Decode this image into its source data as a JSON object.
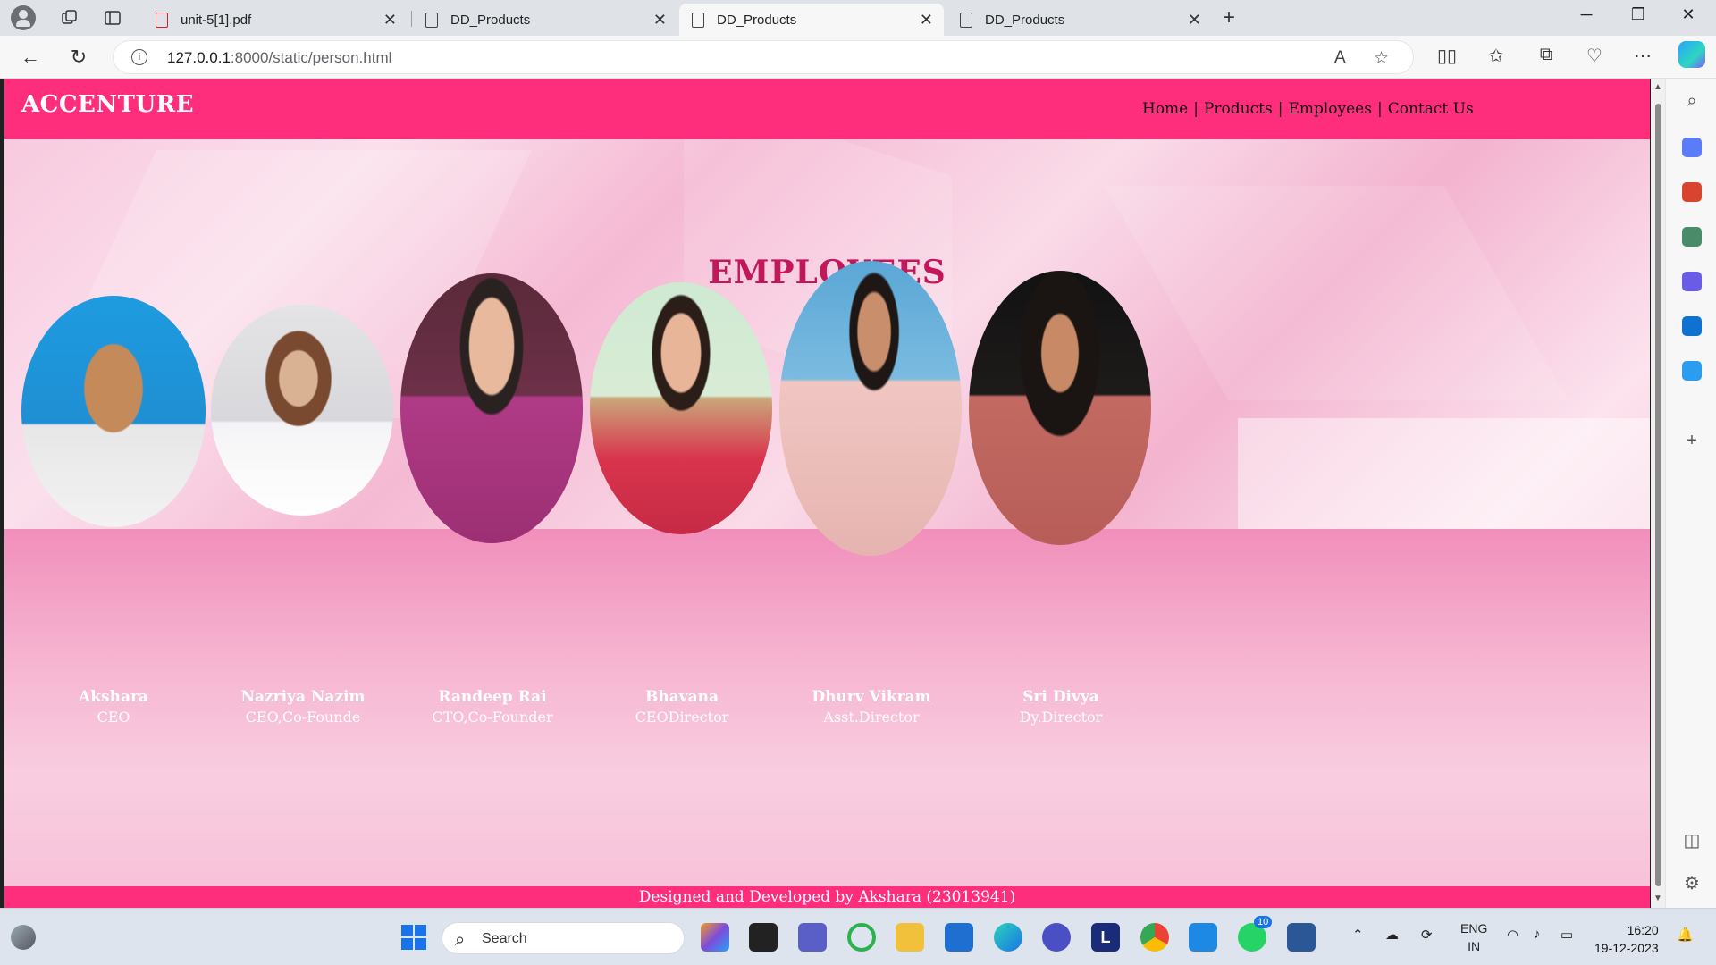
{
  "browser": {
    "tabs": [
      {
        "title": "unit-5[1].pdf",
        "icon": "pdf-icon",
        "active": false
      },
      {
        "title": "DD_Products",
        "icon": "page-icon",
        "active": false
      },
      {
        "title": "DD_Products",
        "icon": "page-icon",
        "active": true
      },
      {
        "title": "DD_Products",
        "icon": "page-icon",
        "active": false
      }
    ],
    "address": {
      "host": "127.0.0.1",
      "path": ":8000/static/person.html"
    }
  },
  "page": {
    "brand": "ACCENTURE",
    "nav": [
      "Home",
      "Products",
      "Employees",
      "Contact Us"
    ],
    "nav_separator": "|",
    "heading": "EMPLOYEES",
    "employees": [
      {
        "name": "Akshara",
        "role": "CEO"
      },
      {
        "name": "Nazriya Nazim",
        "role": "CEO,Co-Founde"
      },
      {
        "name": "Randeep Rai",
        "role": "CTO,Co-Founder"
      },
      {
        "name": "Bhavana",
        "role": "CEODirector"
      },
      {
        "name": "Dhurv Vikram",
        "role": "Asst.Director"
      },
      {
        "name": "Sri Divya",
        "role": "Dy.Director"
      }
    ],
    "footer": "Designed and Developed by Akshara (23013941)",
    "colors": {
      "accent": "#fe2e7c",
      "heading": "#c2185b"
    }
  },
  "taskbar": {
    "search_placeholder": "Search",
    "whatsapp_badge": "10",
    "language": "ENG",
    "region": "IN",
    "time": "16:20",
    "date": "19-12-2023"
  }
}
